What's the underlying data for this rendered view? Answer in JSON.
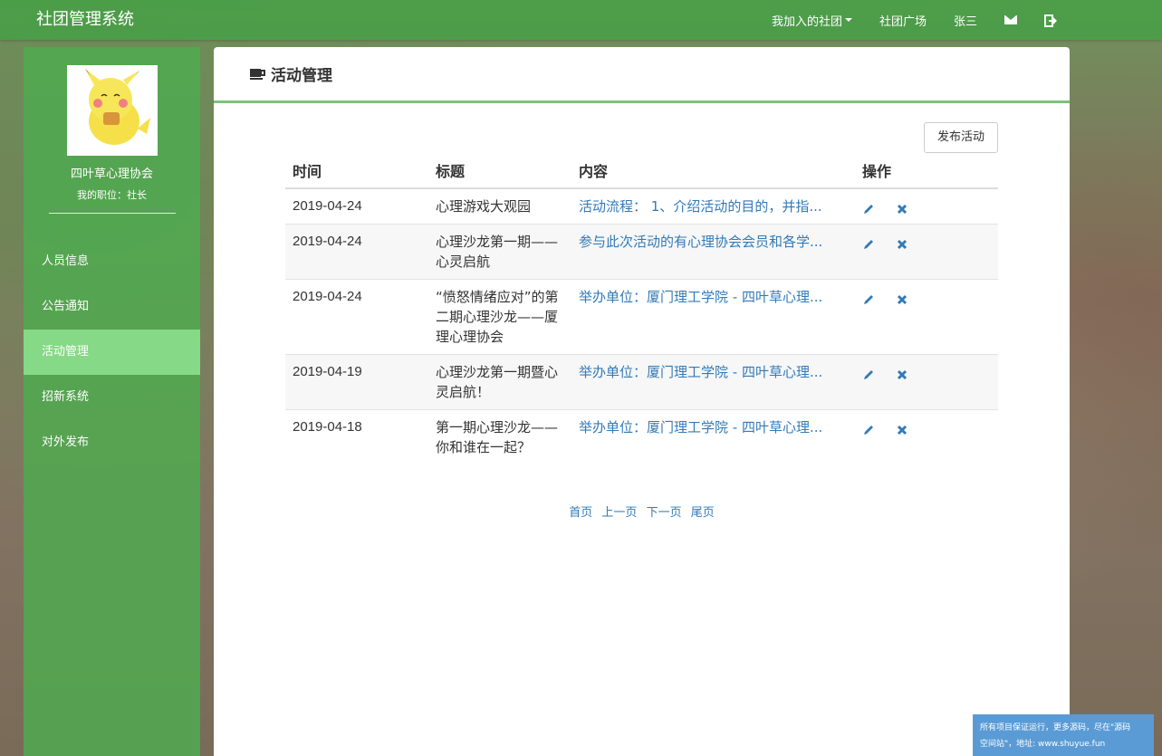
{
  "app": {
    "title": "社团管理系统"
  },
  "nav": {
    "joined_clubs": "我加入的社团",
    "club_square": "社团广场",
    "user_name": "张三"
  },
  "sidebar": {
    "org_name": "四叶草心理协会",
    "position": "我的职位：社长",
    "items": [
      {
        "label": "人员信息"
      },
      {
        "label": "公告通知"
      },
      {
        "label": "活动管理"
      },
      {
        "label": "招新系统"
      },
      {
        "label": "对外发布"
      }
    ]
  },
  "panel": {
    "title": "活动管理",
    "publish_label": "发布活动"
  },
  "table": {
    "headers": [
      "时间",
      "标题",
      "内容",
      "操作"
    ],
    "rows": [
      {
        "time": "2019-04-24",
        "title": "心理游戏大观园",
        "content": "活动流程： 1、介绍活动的目的，并指..."
      },
      {
        "time": "2019-04-24",
        "title": "心理沙龙第一期——心灵启航",
        "content": "参与此次活动的有心理协会会员和各学..."
      },
      {
        "time": "2019-04-24",
        "title": "“愤怒情绪应对”的第二期心理沙龙——厦理心理协会",
        "content": "举办单位：厦门理工学院 - 四叶草心理..."
      },
      {
        "time": "2019-04-19",
        "title": "心理沙龙第一期暨心灵启航！",
        "content": "举办单位：厦门理工学院 - 四叶草心理..."
      },
      {
        "time": "2019-04-18",
        "title": "第一期心理沙龙——你和谁在一起？",
        "content": "举办单位：厦门理工学院 - 四叶草心理..."
      }
    ]
  },
  "pager": {
    "first": "首页",
    "prev": "上一页",
    "next": "下一页",
    "last": "尾页"
  },
  "watermark": {
    "line1": "所有项目保证运行，更多源码，尽在\"源码",
    "line2": "空间站\"，地址: www.shuyue.fun"
  },
  "colors": {
    "navbar": "#46a046",
    "sidebar": "#50aa50",
    "active_item": "#86d986",
    "link": "#337ab7",
    "accent_line": "#7bc47b"
  }
}
